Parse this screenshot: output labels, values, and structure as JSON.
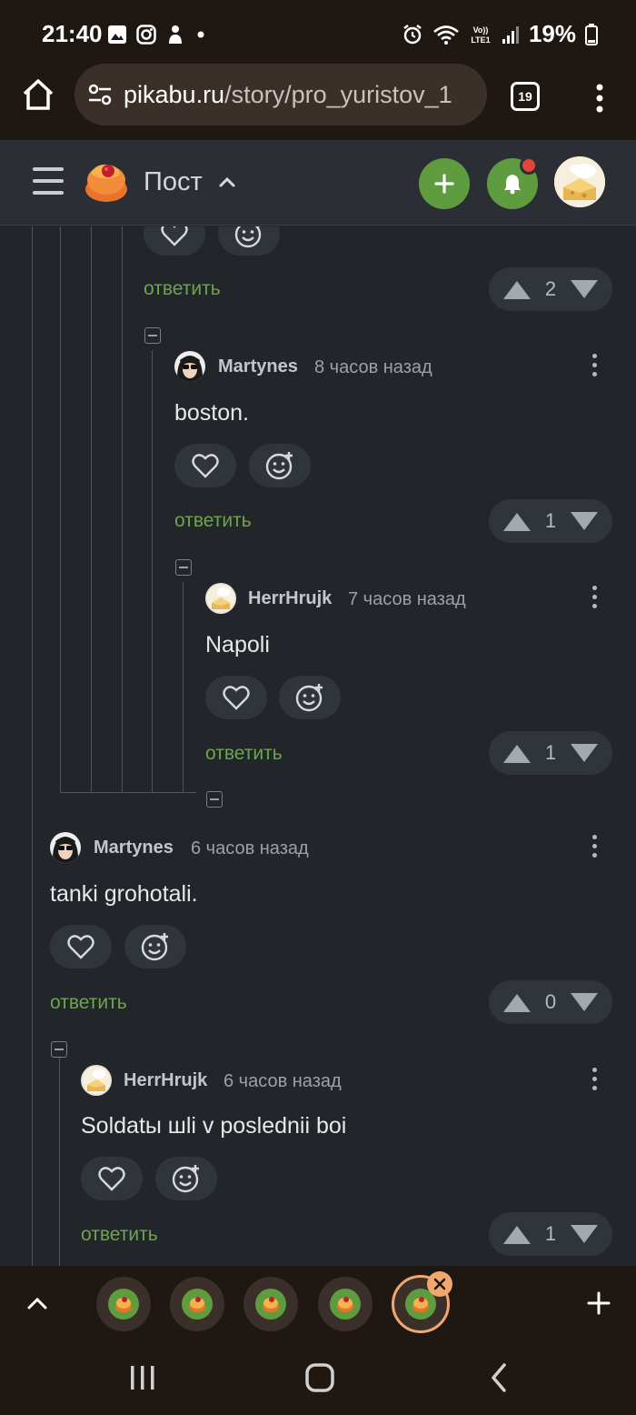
{
  "status_bar": {
    "time": "21:40",
    "battery": "19%",
    "icons_left": [
      "gallery-icon",
      "instagram-icon",
      "app-icon",
      "dot-icon"
    ],
    "icons_right": [
      "alarm-icon",
      "wifi-icon",
      "volte-icon",
      "signal-icon",
      "battery-icon"
    ]
  },
  "browser": {
    "url_host": "pikabu.ru",
    "url_path": "/story/pro_yuristov_1",
    "tab_count": "19"
  },
  "header": {
    "title": "Пост"
  },
  "comments": [
    {
      "id": "c0",
      "vote": "2",
      "reply_label": "ответить"
    },
    {
      "id": "c1",
      "user": "Martynes",
      "time": "8 часов назад",
      "text": "boston.",
      "vote": "1",
      "reply_label": "ответить"
    },
    {
      "id": "c2",
      "user": "HerrHrujk",
      "time": "7 часов назад",
      "text": "Napoli",
      "vote": "1",
      "reply_label": "ответить"
    },
    {
      "id": "c3",
      "user": "Martynes",
      "time": "6 часов назад",
      "text": "tanki grohotali.",
      "vote": "0",
      "reply_label": "ответить"
    },
    {
      "id": "c4",
      "user": "HerrHrujk",
      "time": "6 часов назад",
      "text": "Soldatы шli v poslednii boi",
      "vote": "1",
      "reply_label": "ответить"
    }
  ],
  "colors": {
    "accent_green": "#5f9c3f",
    "reply_green": "#6fa44e",
    "notification_red": "#e0443a",
    "active_tab_ring": "#f2a86d"
  }
}
